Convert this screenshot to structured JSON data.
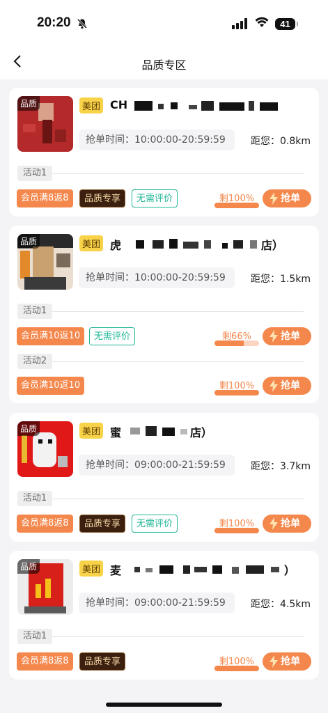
{
  "status_bar": {
    "time": "20:20",
    "battery": "41"
  },
  "nav": {
    "title": "品质专区"
  },
  "cards": [
    {
      "quality_tag": "品质",
      "platform": "美团",
      "shop_name": "CH",
      "grab_time": "抢单时间：10:00:00-20:59:59",
      "distance": "距您：0.8km",
      "activities": [
        {
          "label": "活动1",
          "badges": [
            "会员满8返8",
            "品质专享",
            "无需评价"
          ],
          "remain": "剩100%",
          "remain_fraction": 1.0,
          "button": "抢单"
        }
      ]
    },
    {
      "quality_tag": "品质",
      "platform": "美团",
      "shop_name": "虎",
      "shop_name_end": "店）",
      "grab_time": "抢单时间：10:00:00-20:59:59",
      "distance": "距您：1.5km",
      "activities": [
        {
          "label": "活动1",
          "badges": [
            "会员满10返10",
            "无需评价"
          ],
          "remain": "剩66%",
          "remain_fraction": 0.66,
          "button": "抢单"
        },
        {
          "label": "活动2",
          "badges": [
            "会员满10返10"
          ],
          "remain": "剩100%",
          "remain_fraction": 1.0,
          "button": "抢单"
        }
      ]
    },
    {
      "quality_tag": "品质",
      "platform": "美团",
      "shop_name": "蜜",
      "shop_name_end": "店）",
      "grab_time": "抢单时间：09:00:00-21:59:59",
      "distance": "距您：3.7km",
      "activities": [
        {
          "label": "活动1",
          "badges": [
            "会员满8返8",
            "品质专享",
            "无需评价"
          ],
          "remain": "剩100%",
          "remain_fraction": 1.0,
          "button": "抢单"
        }
      ]
    },
    {
      "quality_tag": "品质",
      "platform": "美团",
      "shop_name": "麦",
      "shop_name_end": "）",
      "grab_time": "抢单时间：09:00:00-21:59:59",
      "distance": "距您：4.5km",
      "activities": [
        {
          "label": "活动1",
          "badges": [
            "会员满8返8",
            "品质专享"
          ],
          "remain": "剩100%",
          "remain_fraction": 1.0,
          "button": "抢单"
        }
      ]
    }
  ],
  "colors": {
    "accent": "#f4874b",
    "platform_tag": "#f8d34a",
    "green": "#1fb595",
    "dark_badge": "#3b2010"
  },
  "icons": {
    "back": "chevron-left-icon",
    "bell": "bell-slash-icon",
    "signal": "signal-icon",
    "wifi": "wifi-icon",
    "grab": "lightning-icon"
  }
}
